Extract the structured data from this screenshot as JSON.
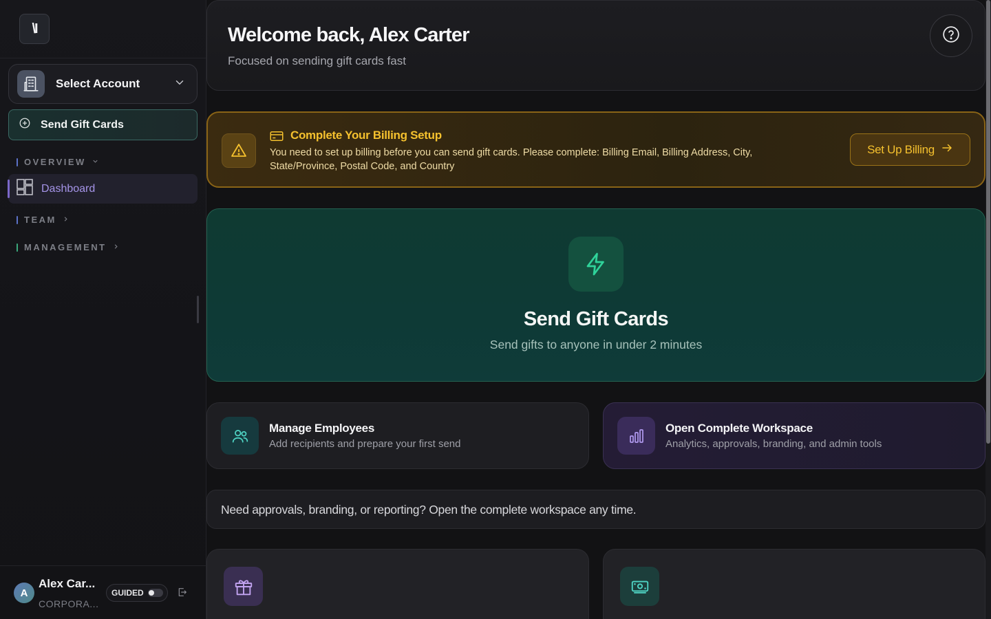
{
  "sidebar": {
    "logo_text": "\\I",
    "account_select_label": "Select Account",
    "send_button_label": "Send Gift Cards",
    "sections": {
      "overview": "OVERVIEW",
      "team": "TEAM",
      "management": "MANAGEMENT"
    },
    "nav_dashboard": "Dashboard",
    "user": {
      "initial": "A",
      "name": "Alex Car...",
      "org": "CORPORA...",
      "mode_label": "GUIDED"
    }
  },
  "header": {
    "title": "Welcome back, Alex Carter",
    "subtitle": "Focused on sending gift cards fast"
  },
  "billing": {
    "title": "Complete Your Billing Setup",
    "text": "You need to set up billing before you can send gift cards. Please complete: Billing Email, Billing Address, City, State/Province, Postal Code, and Country",
    "button": "Set Up Billing"
  },
  "hero": {
    "title": "Send Gift Cards",
    "subtitle": "Send gifts to anyone in under 2 minutes"
  },
  "cards": {
    "employees": {
      "title": "Manage Employees",
      "subtitle": "Add recipients and prepare your first send"
    },
    "workspace": {
      "title": "Open Complete Workspace",
      "subtitle": "Analytics, approvals, branding, and admin tools"
    }
  },
  "note": "Need approvals, branding, or reporting? Open the complete workspace any time.",
  "colors": {
    "accent_green": "#2fd39a",
    "accent_gold": "#f5c12e",
    "accent_purple": "#a594e8",
    "background": "#121214"
  }
}
